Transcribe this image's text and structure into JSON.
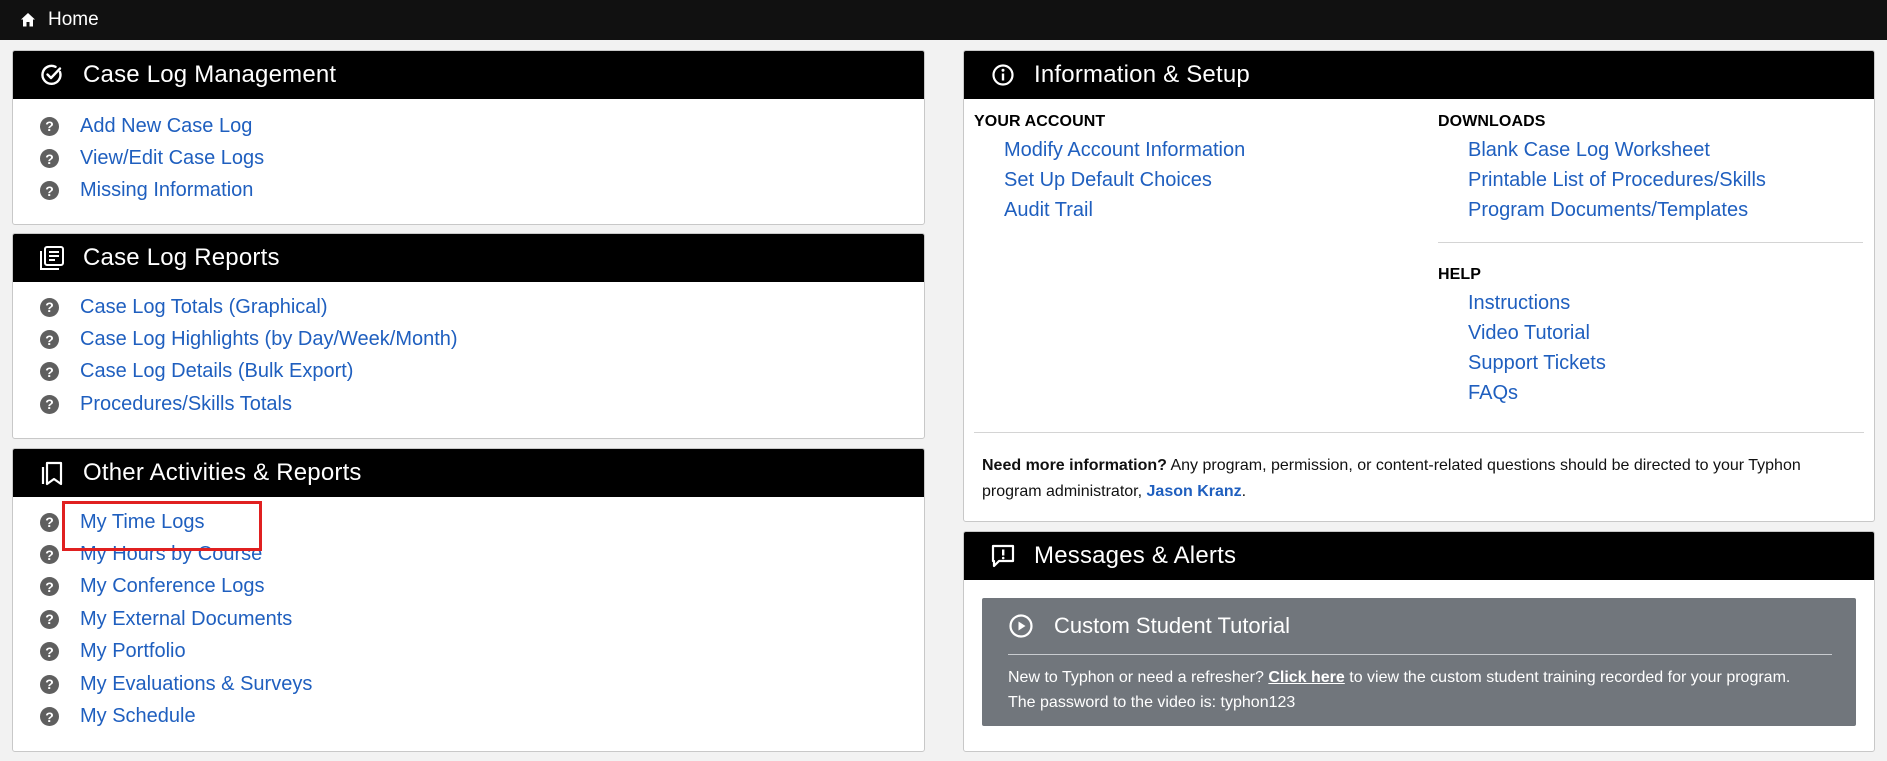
{
  "topbar": {
    "home_label": "Home"
  },
  "case_log_management": {
    "title": "Case Log Management",
    "items": [
      "Add New Case Log",
      "View/Edit Case Logs",
      "Missing Information"
    ]
  },
  "case_log_reports": {
    "title": "Case Log Reports",
    "items": [
      "Case Log Totals (Graphical)",
      "Case Log Highlights (by Day/Week/Month)",
      "Case Log Details (Bulk Export)",
      "Procedures/Skills Totals"
    ]
  },
  "other_activities": {
    "title": "Other Activities & Reports",
    "items": [
      "My Time Logs",
      "My Hours by Course",
      "My Conference Logs",
      "My External Documents",
      "My Portfolio",
      "My Evaluations & Surveys",
      "My Schedule"
    ]
  },
  "info_setup": {
    "title": "Information & Setup",
    "your_account_label": "YOUR ACCOUNT",
    "your_account_links": [
      "Modify Account Information",
      "Set Up Default Choices",
      "Audit Trail"
    ],
    "downloads_label": "DOWNLOADS",
    "downloads_links": [
      "Blank Case Log Worksheet",
      "Printable List of Procedures/Skills",
      "Program Documents/Templates"
    ],
    "help_label": "HELP",
    "help_links": [
      "Instructions",
      "Video Tutorial",
      "Support Tickets",
      "FAQs"
    ],
    "note_bold": "Need more information?",
    "note_text_1": " Any program, permission, or content-related questions should be directed to your Typhon",
    "note_text_2": "program administrator, ",
    "admin_name": "Jason Kranz",
    "note_end": "."
  },
  "messages": {
    "title": "Messages & Alerts",
    "card_title": "Custom Student Tutorial",
    "body_1a": "New to Typhon or need a refresher? ",
    "body_link": "Click here",
    "body_1b": " to view the custom student training recorded for your program.",
    "body_2": "The password to the video is: typhon123"
  }
}
